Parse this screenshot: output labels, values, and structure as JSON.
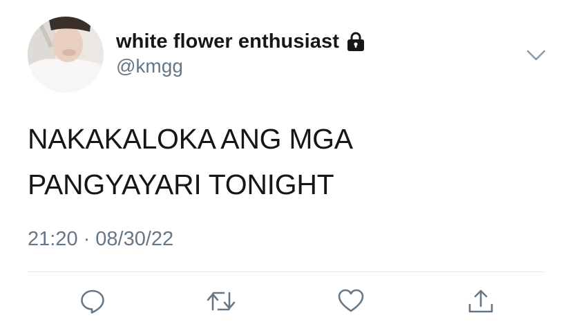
{
  "tweet": {
    "display_name": "white flower enthusiast",
    "handle": "@kmgg",
    "text_line1": "NAKAKALOKA ANG MGA",
    "text_line2": "PANGYAYARI TONIGHT",
    "time": "21:20",
    "separator": "·",
    "date": "08/30/22",
    "protected_icon": "lock-icon",
    "menu_icon": "chevron-down-icon"
  },
  "actions": [
    {
      "icon": "reply-icon"
    },
    {
      "icon": "retweet-icon"
    },
    {
      "icon": "heart-icon"
    },
    {
      "icon": "share-icon"
    }
  ],
  "colors": {
    "text": "#14171a",
    "secondary": "#657786",
    "icon": "#657786",
    "divider": "#e1e8ed"
  }
}
